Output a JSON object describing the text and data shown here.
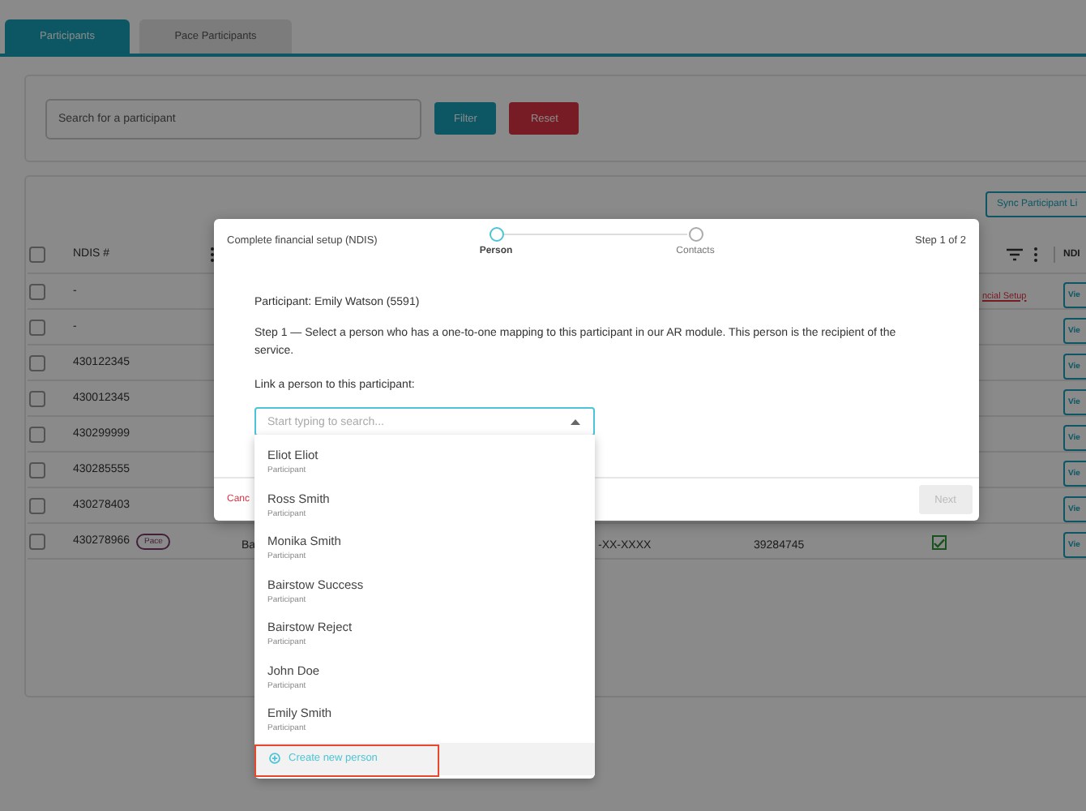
{
  "tabs": [
    {
      "label": "Participants",
      "selected": true
    },
    {
      "label": "Pace Participants",
      "selected": false
    }
  ],
  "filter": {
    "placeholder": "Search for a participant",
    "filter_button": "Filter",
    "reset_button": "Reset"
  },
  "table": {
    "sync_button": "Sync Participant Li",
    "header": {
      "checked": false,
      "column_1": "NDIS #",
      "column_last": "NDI"
    },
    "rows": [
      {
        "checked": false,
        "ndis": "-",
        "link": "ncial Setup",
        "view": "Vie"
      },
      {
        "checked": false,
        "ndis": "-",
        "view": "Vie"
      },
      {
        "checked": false,
        "ndis": "430122345",
        "view": "Vie"
      },
      {
        "checked": false,
        "ndis": "430012345",
        "view": "Vie"
      },
      {
        "checked": false,
        "ndis": "430299999",
        "view": "Vie"
      },
      {
        "checked": false,
        "ndis": "430285555",
        "view": "Vie"
      },
      {
        "checked": false,
        "ndis": "430278403",
        "view": "Vie"
      },
      {
        "checked": false,
        "ndis": "430278966",
        "badge": "Pace",
        "column_3": "Ba",
        "column_4": "-XX-XXXX",
        "column_5": "39284745",
        "verified": true,
        "view": "Vie"
      }
    ]
  },
  "modal": {
    "title": "Complete financial setup (NDIS)",
    "steps": [
      {
        "label": "Person",
        "selected": true
      },
      {
        "label": "Contacts",
        "selected": false
      }
    ],
    "step_counter": "Step 1 of 2",
    "participant": "Participant: Emily Watson (5591)",
    "instruction": "Step 1 — Select a person who has a one-to-one mapping to this participant in our AR module. This person is the recipient of the service.",
    "field_label": "Link a person to this participant:",
    "select": {
      "placeholder": "Start typing to search...",
      "expanded": true
    },
    "cancel": "Canc",
    "next": {
      "label": "Next",
      "disabled": true
    }
  },
  "dropdown": {
    "options": [
      {
        "name": "Eliot Eliot",
        "role": "Participant"
      },
      {
        "name": "Ross Smith",
        "role": "Participant"
      },
      {
        "name": "Monika Smith",
        "role": "Participant"
      },
      {
        "name": "Bairstow Success",
        "role": "Participant"
      },
      {
        "name": "Bairstow Reject",
        "role": "Participant"
      },
      {
        "name": "John Doe",
        "role": "Participant"
      },
      {
        "name": "Emily Smith",
        "role": "Participant"
      }
    ],
    "create_option": {
      "label": "Create new person",
      "highlighted": true
    }
  }
}
